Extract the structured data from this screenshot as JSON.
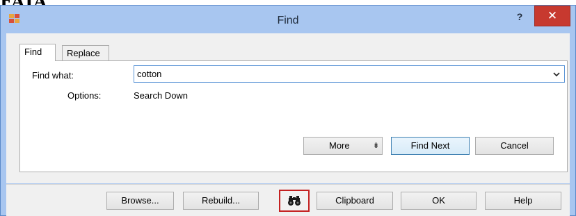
{
  "background": {
    "clipped_text": "FAIA"
  },
  "window": {
    "title": "Find",
    "help_glyph": "?",
    "close_glyph": "✕"
  },
  "tabs": [
    {
      "label": "Find",
      "active": true
    },
    {
      "label": "Replace",
      "active": false
    }
  ],
  "find_panel": {
    "find_what_label": "Find what:",
    "find_what_value": "cotton",
    "options_label": "Options:",
    "options_value": "Search Down"
  },
  "panel_buttons": {
    "more_label": "More",
    "more_arrow": "⇟",
    "find_next_label": "Find Next",
    "cancel_label": "Cancel"
  },
  "bottom_buttons": {
    "browse_label": "Browse...",
    "rebuild_label": "Rebuild...",
    "search_icon": "binoculars-icon",
    "clipboard_label": "Clipboard",
    "ok_label": "OK",
    "help_label": "Help"
  },
  "colors": {
    "titlebar": "#a8c6f0",
    "close_button": "#c7392f",
    "highlight_border": "#c42121",
    "focus_border": "#5b95d6"
  }
}
